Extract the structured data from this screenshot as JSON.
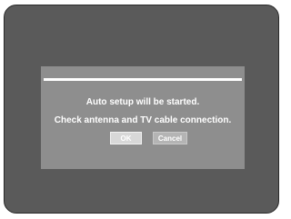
{
  "dialog": {
    "line1": "Auto setup will be started.",
    "line2": "Check antenna and TV cable connection.",
    "ok_label": "OK",
    "cancel_label": "Cancel"
  },
  "colors": {
    "screen_background": "#5a5a5a",
    "dialog_background": "#8e8e8e",
    "text": "#ffffff",
    "ok_selected": "#d8d8d8",
    "cancel": "#b4b4b4"
  }
}
